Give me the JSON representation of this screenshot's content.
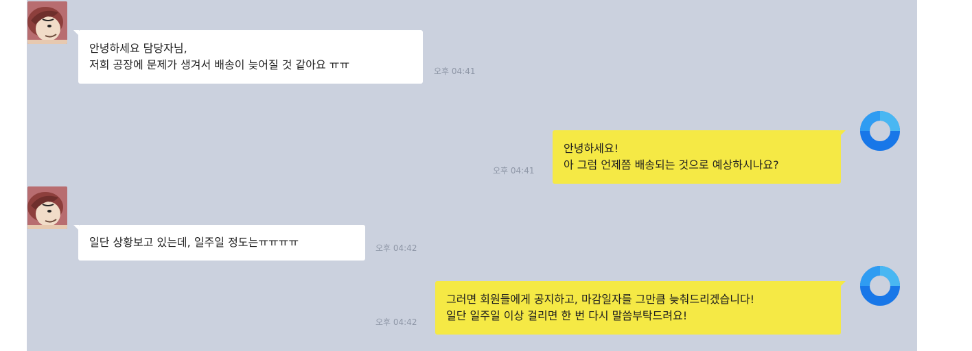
{
  "messages": [
    {
      "side": "left",
      "lines": [
        "안녕하세요 담당자님,",
        "저희 공장에 문제가 생겨서 배송이 늦어질 것 같아요 ㅠㅠ"
      ],
      "time": "오후 04:41",
      "avatar_icon": "cartoon-character-avatar-icon"
    },
    {
      "side": "right",
      "lines": [
        "안녕하세요!",
        "아 그럼 언제쯤 배송되는 것으로 예상하시나요?"
      ],
      "time": "오후 04:41",
      "avatar_icon": "blue-ring-avatar-icon"
    },
    {
      "side": "left",
      "lines": [
        "일단 상황보고 있는데, 일주일 정도는ㅠㅠㅠㅠ"
      ],
      "time": "오후 04:42",
      "avatar_icon": "cartoon-character-avatar-icon"
    },
    {
      "side": "right",
      "lines": [
        "그러면 회원들에게 공지하고, 마감일자를 그만큼 늦춰드리겠습니다!",
        "일단 일주일 이상 걸리면 한 번 다시 말씀부탁드려요!"
      ],
      "time": "오후 04:42",
      "avatar_icon": "blue-ring-avatar-icon"
    }
  ],
  "colors": {
    "chat_background": "#cbd1de",
    "my_bubble": "#f5e945",
    "friend_bubble": "#ffffff",
    "timestamp": "#8e96a6",
    "ring_blue": "#1877e8"
  }
}
